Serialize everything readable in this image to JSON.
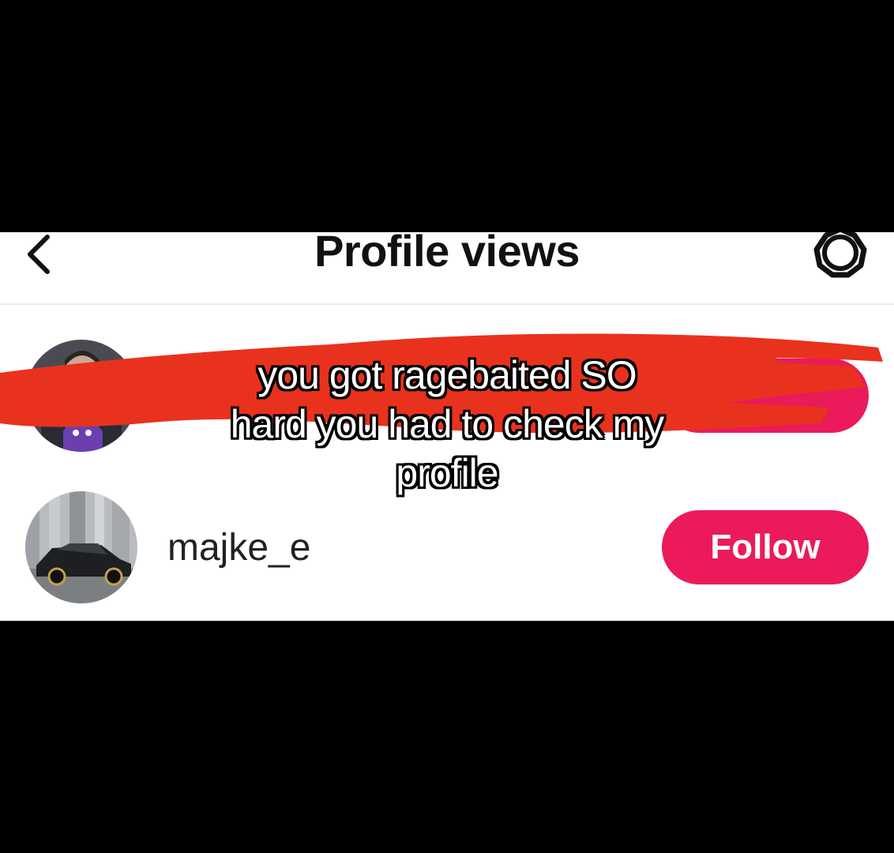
{
  "header": {
    "title": "Profile views",
    "back_icon": "chevron-left-icon",
    "settings_icon": "gear-icon"
  },
  "viewers": [
    {
      "username": "",
      "follow_label": "",
      "avatar": "person-with-anime-character-avatar"
    },
    {
      "username": "majke_e",
      "follow_label": "Follow",
      "avatar": "dark-sedan-car-avatar"
    }
  ],
  "overlay": {
    "caption_lines": [
      "you got ragebaited SO",
      "hard you had to check my",
      "profile"
    ],
    "scribble_color": "#e8321e"
  },
  "colors": {
    "background_bars": "#000000",
    "screen_background": "#ffffff",
    "follow_button": "#ea1a5b",
    "title_text": "#111111"
  }
}
